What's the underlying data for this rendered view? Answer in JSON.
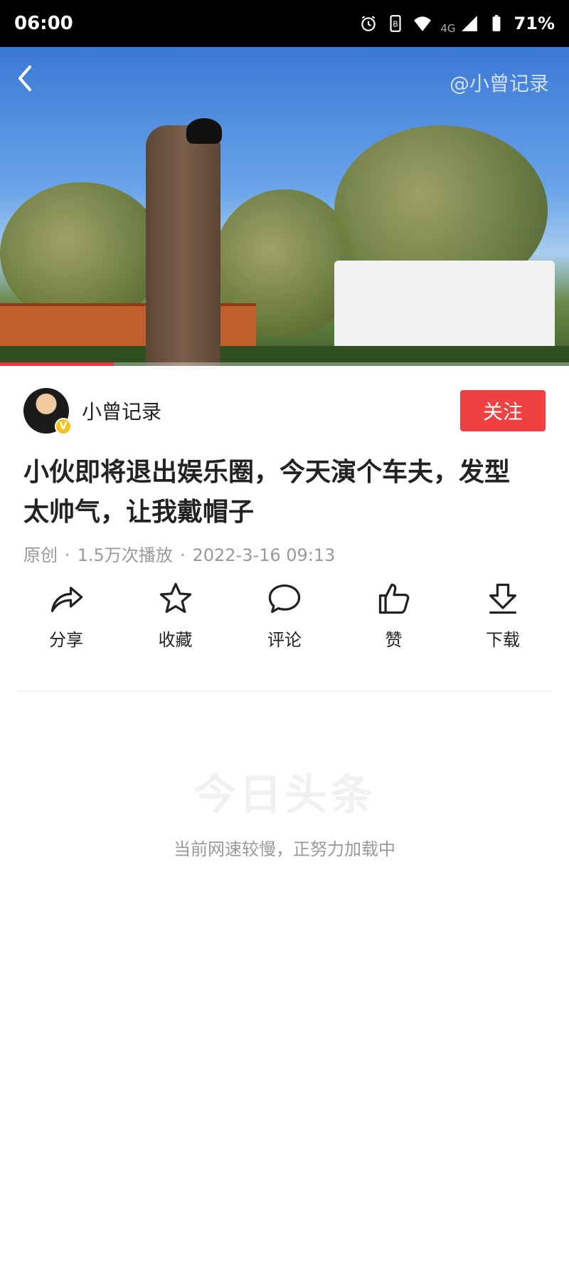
{
  "status_bar": {
    "time": "06:00",
    "network": "4G",
    "battery": "71%"
  },
  "video": {
    "watermark": "@小曾记录",
    "progress": 0.2
  },
  "author": {
    "name": "小曾记录",
    "badge": "V",
    "follow_label": "关注"
  },
  "article": {
    "title": "小伙即将退出娱乐圈，今天演个车夫，发型太帅气，让我戴帽子",
    "meta_original": "原创",
    "meta_plays": "1.5万次播放",
    "meta_date": "2022-3-16 09:13"
  },
  "actions": [
    {
      "label": "分享",
      "icon": "share-icon"
    },
    {
      "label": "收藏",
      "icon": "star-icon"
    },
    {
      "label": "评论",
      "icon": "comment-icon"
    },
    {
      "label": "赞",
      "icon": "thumbs-up-icon"
    },
    {
      "label": "下载",
      "icon": "download-icon"
    }
  ],
  "loading": {
    "logo_text": "今日头条",
    "message": "当前网速较慢，正努力加载中"
  },
  "colors": {
    "accent": "#f04142",
    "badge": "#f8c21c"
  }
}
